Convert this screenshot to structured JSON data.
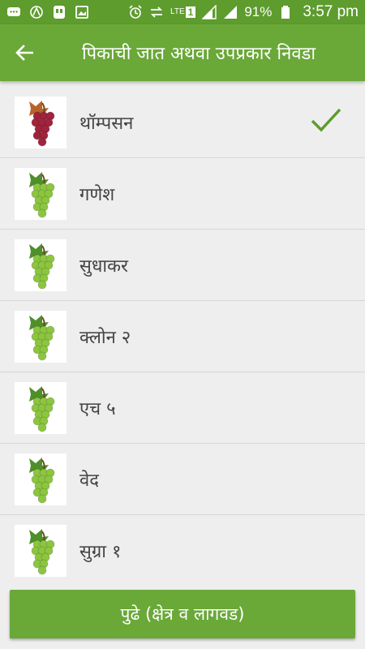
{
  "status_bar": {
    "network": "LTE",
    "sim_slot": "1",
    "battery": "91%",
    "time": "3:57 pm"
  },
  "header": {
    "title": "पिकाची जात अथवा उपप्रकार निवडा"
  },
  "varieties": [
    {
      "label": "थॉम्पसन",
      "icon": "red-grapes-icon",
      "selected": true
    },
    {
      "label": "गणेश",
      "icon": "green-grapes-icon",
      "selected": false
    },
    {
      "label": "सुधाकर",
      "icon": "green-grapes-icon",
      "selected": false
    },
    {
      "label": "क्लोन २",
      "icon": "green-grapes-icon",
      "selected": false
    },
    {
      "label": "एच ५",
      "icon": "green-grapes-icon",
      "selected": false
    },
    {
      "label": "वेद",
      "icon": "green-grapes-icon",
      "selected": false
    },
    {
      "label": "सुग्रा १",
      "icon": "green-grapes-icon",
      "selected": false
    }
  ],
  "footer": {
    "next_label": "पुढे (क्षेत्र व लागवड)"
  },
  "colors": {
    "primary": "#6aa838",
    "status_bar": "#5e9c2e",
    "check": "#5e9c2e",
    "red_grape": "#a0243c",
    "green_grape": "#8cc63f"
  }
}
